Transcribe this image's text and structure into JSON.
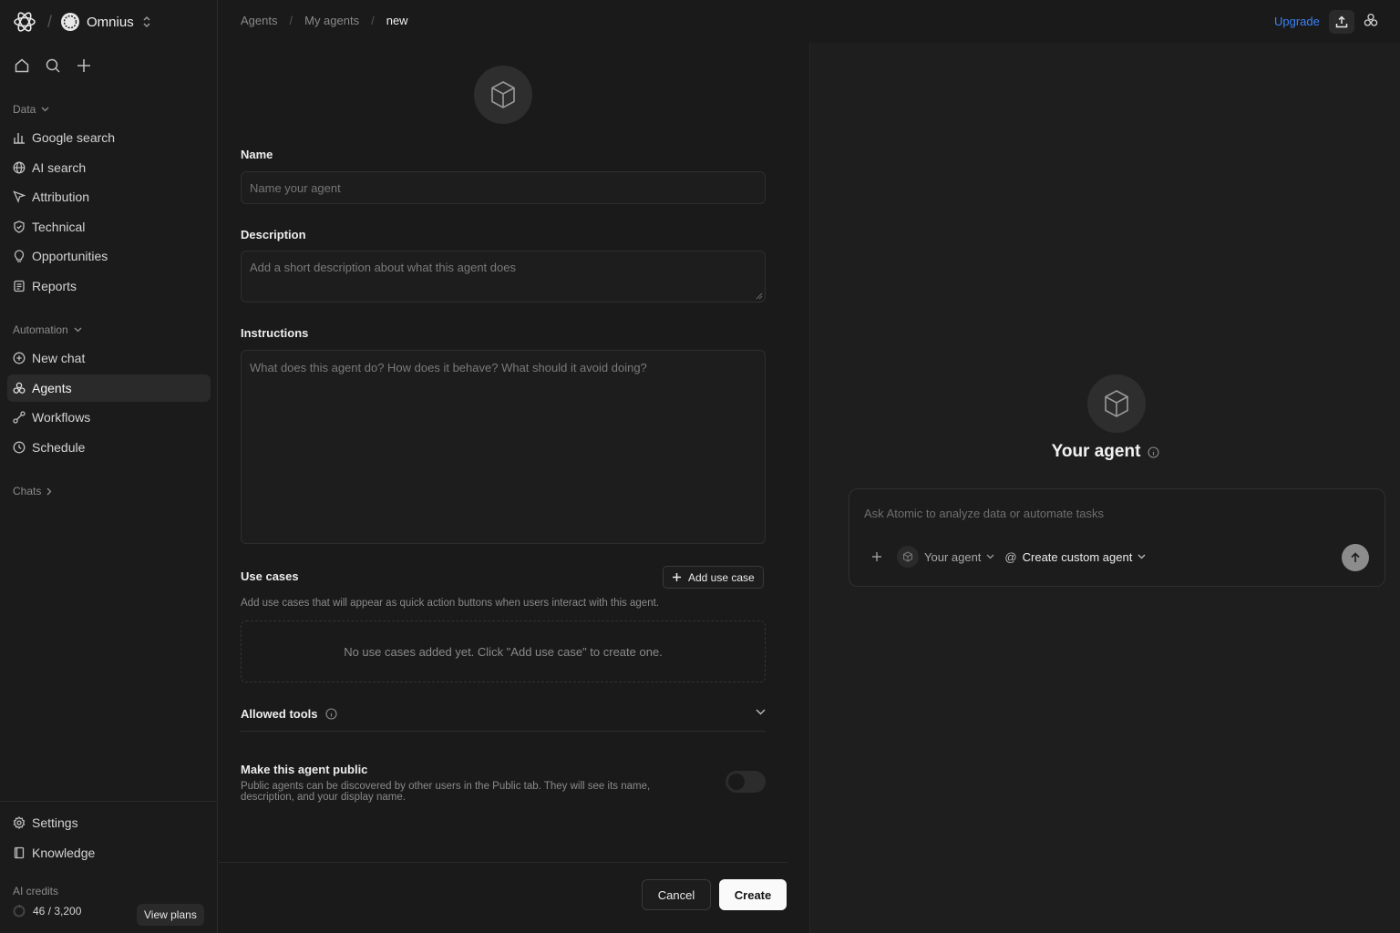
{
  "workspace": {
    "name": "Omnius"
  },
  "sidebar": {
    "data_section": "Data",
    "data_items": [
      {
        "label": "Google search",
        "icon": "bar-chart-icon"
      },
      {
        "label": "AI search",
        "icon": "globe-icon"
      },
      {
        "label": "Attribution",
        "icon": "cursor-icon"
      },
      {
        "label": "Technical",
        "icon": "shield-icon"
      },
      {
        "label": "Opportunities",
        "icon": "lightbulb-icon"
      },
      {
        "label": "Reports",
        "icon": "report-icon"
      }
    ],
    "automation_section": "Automation",
    "automation_items": [
      {
        "label": "New chat",
        "icon": "plus-circle-icon"
      },
      {
        "label": "Agents",
        "icon": "agents-icon",
        "active": true
      },
      {
        "label": "Workflows",
        "icon": "workflow-icon"
      },
      {
        "label": "Schedule",
        "icon": "clock-icon"
      }
    ],
    "chats_section": "Chats",
    "bottom_items": [
      {
        "label": "Settings",
        "icon": "gear-icon"
      },
      {
        "label": "Knowledge",
        "icon": "book-icon"
      }
    ],
    "credits_label": "AI credits",
    "credits_value": "46 / 3,200",
    "view_plans": "View plans"
  },
  "breadcrumb": [
    "Agents",
    "My agents",
    "new"
  ],
  "topbar": {
    "upgrade": "Upgrade"
  },
  "form": {
    "name_label": "Name",
    "name_placeholder": "Name your agent",
    "description_label": "Description",
    "description_placeholder": "Add a short description about what this agent does",
    "instructions_label": "Instructions",
    "instructions_placeholder": "What does this agent do? How does it behave? What should it avoid doing?",
    "use_cases_label": "Use cases",
    "add_use_case": "Add use case",
    "use_cases_hint": "Add use cases that will appear as quick action buttons when users interact with this agent.",
    "use_cases_empty": "No use cases added yet. Click \"Add use case\" to create one.",
    "allowed_tools_label": "Allowed tools",
    "public_label": "Make this agent public",
    "public_hint": "Public agents can be discovered by other users in the Public tab. They will see its name, description, and your display name.",
    "public_enabled": false,
    "cancel": "Cancel",
    "create": "Create"
  },
  "preview": {
    "title": "Your agent",
    "chat_placeholder": "Ask Atomic to analyze data or automate tasks",
    "agent_select": "Your agent",
    "mode_select": "Create custom agent"
  },
  "colors": {
    "accent_link": "#3b82f6",
    "background": "#1a1a1a"
  }
}
